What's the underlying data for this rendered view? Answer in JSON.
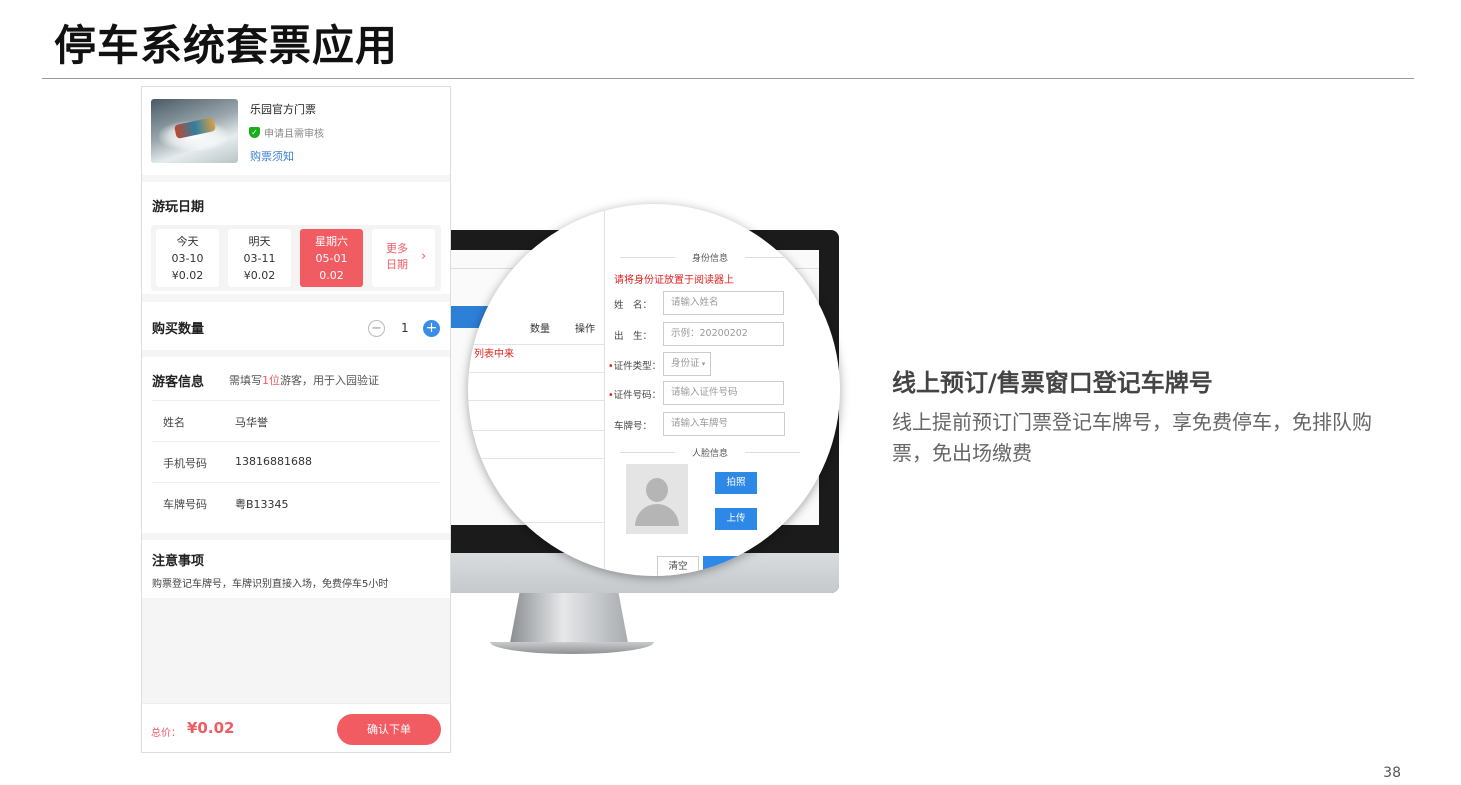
{
  "slide": {
    "title": "停车系统套票应用",
    "page_number": "38"
  },
  "phone": {
    "product": {
      "name": "乐园官方门票",
      "approval": "申请且需审核",
      "notice_link": "购票须知"
    },
    "date_section": {
      "heading": "游玩日期",
      "dates": [
        {
          "day": "今天",
          "date": "03-10",
          "price": "¥0.02"
        },
        {
          "day": "明天",
          "date": "03-11",
          "price": "¥0.02"
        },
        {
          "day": "星期六",
          "date": "05-01",
          "price": "0.02"
        }
      ],
      "more_line1": "更多",
      "more_line2": "日期"
    },
    "quantity": {
      "heading": "购买数量",
      "value": "1",
      "minus": "−",
      "plus": "+"
    },
    "visitor": {
      "heading": "游客信息",
      "hint_before": "需填写",
      "hint_count": "1位",
      "hint_after": "游客，用于入园验证",
      "rows": [
        {
          "label": "姓名",
          "value": "马华誉"
        },
        {
          "label": "手机号码",
          "value": "13816881688"
        },
        {
          "label": "车牌号码",
          "value": "粤B13345"
        }
      ]
    },
    "notes": {
      "heading": "注意事项",
      "text": "购票登记车牌号，车牌识别直接入场，免费停车5小时"
    },
    "footer": {
      "total_label": "总价：",
      "total_value": "¥0.02",
      "order_button": "确认下单"
    }
  },
  "window_form": {
    "columns": [
      "数量",
      "操作"
    ],
    "list_loading": "列表中来",
    "id_group_title": "身份信息",
    "id_reader_hint": "请将身份证放置于阅读器上",
    "fields": [
      {
        "label": "姓　名：",
        "required": false,
        "placeholder": "请输入姓名"
      },
      {
        "label": "出　生：",
        "required": false,
        "placeholder": "示例：20200202"
      },
      {
        "label": "证件类型：",
        "required": true,
        "placeholder": "身份证"
      },
      {
        "label": "证件号码：",
        "required": true,
        "placeholder": "请输入证件号码"
      },
      {
        "label": "车牌号：",
        "required": false,
        "placeholder": "请输入车牌号"
      }
    ],
    "face_group_title": "人脸信息",
    "photo_button": "拍照",
    "upload_button": "上传",
    "clear_button": "清空"
  },
  "feature": {
    "title": "线上预订/售票窗口登记车牌号",
    "description": "线上提前预订门票登记车牌号，享免费停车，免排队购票，免出场缴费"
  },
  "colors": {
    "accent_red": "#f15b62",
    "accent_blue": "#2d88e8",
    "approve_green": "#1aad19"
  }
}
